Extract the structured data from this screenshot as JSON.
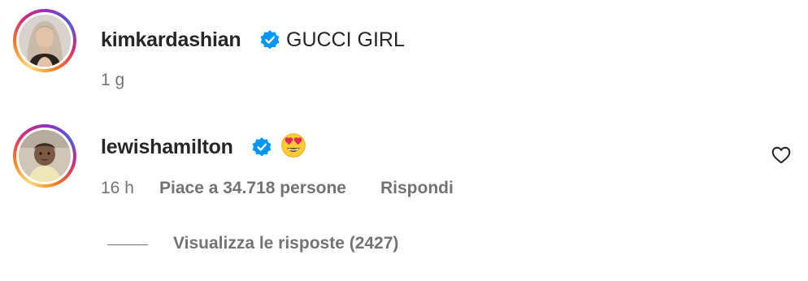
{
  "comments": [
    {
      "username": "kimkardashian",
      "verified": true,
      "text": "GUCCI GIRL",
      "time": "1 g",
      "avatar_icon": "woman-portrait-avatar"
    },
    {
      "username": "lewishamilton",
      "verified": true,
      "emoji": "😍",
      "emoji_icon": "heart-eyes-emoji-icon",
      "time": "16 h",
      "likes": "Piace a 34.718 persone",
      "reply_label": "Rispondi",
      "like_icon": "heart-outline-icon",
      "avatar_icon": "child-portrait-avatar"
    }
  ],
  "view_replies": "Visualizza le risposte (2427)",
  "colors": {
    "text": "#262626",
    "muted": "#737373",
    "verified": "#0095f6"
  }
}
